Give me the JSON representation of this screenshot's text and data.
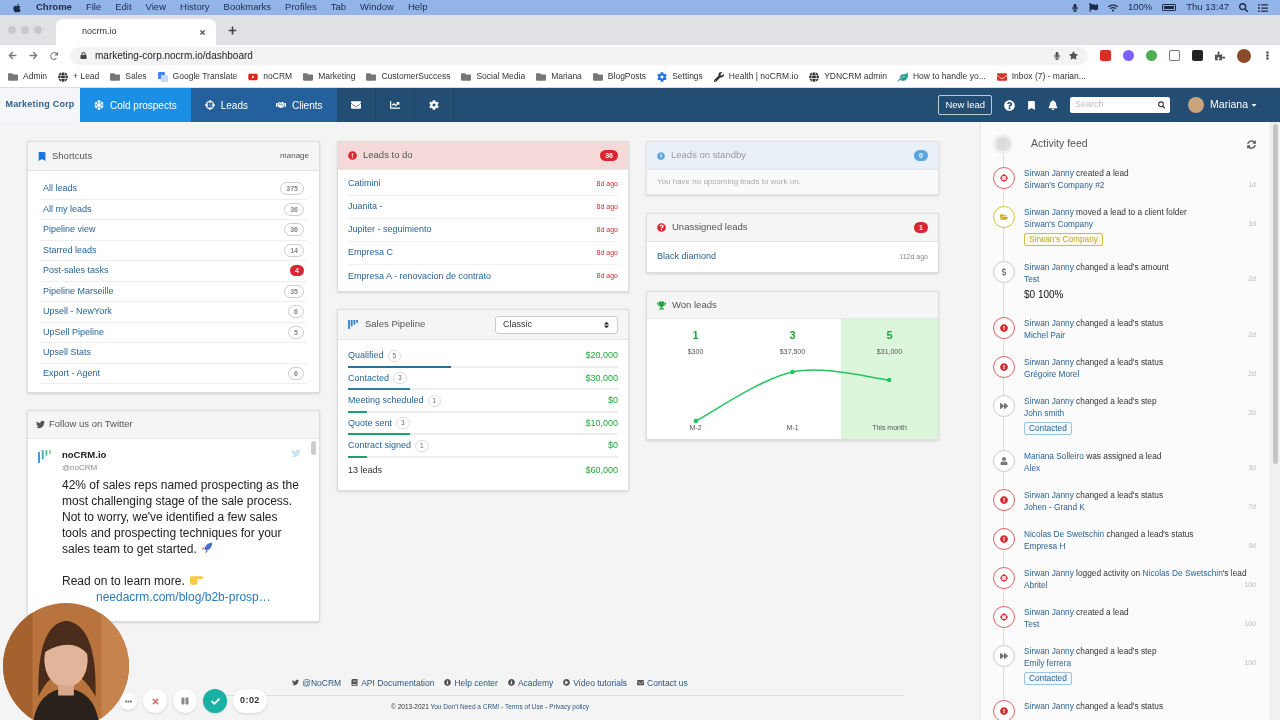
{
  "menu_bar": {
    "app": "Chrome",
    "items": [
      "File",
      "Edit",
      "View",
      "History",
      "Bookmarks",
      "Profiles",
      "Tab",
      "Window",
      "Help"
    ],
    "battery": "100%",
    "clock": "Thu 13:47"
  },
  "browser": {
    "tab": {
      "title": "nocrm.io"
    },
    "url": "marketing-corp.nocrm.io/dashboard",
    "bookmarks": [
      {
        "label": "Admin",
        "kind": "folder"
      },
      {
        "label": "+ Lead",
        "kind": "globe"
      },
      {
        "label": "Sales",
        "kind": "folder"
      },
      {
        "label": "Google Translate",
        "kind": "translate"
      },
      {
        "label": "noCRM",
        "kind": "video"
      },
      {
        "label": "Marketing",
        "kind": "folder"
      },
      {
        "label": "CustomerSuccess",
        "kind": "folder"
      },
      {
        "label": "Social Media",
        "kind": "folder"
      },
      {
        "label": "Mariana",
        "kind": "folder"
      },
      {
        "label": "BlogPosts",
        "kind": "folder"
      },
      {
        "label": "Settings",
        "kind": "gear"
      },
      {
        "label": "Health | noCRM.io",
        "kind": "tool"
      },
      {
        "label": "YDNCRM admin",
        "kind": "globe"
      },
      {
        "label": "How to handle yo...",
        "kind": "leaf"
      },
      {
        "label": "Inbox (7) - marian...",
        "kind": "mail"
      }
    ]
  },
  "nav": {
    "brand": "Marketing Corp",
    "items": [
      {
        "kind": "cold",
        "label": "Cold prospects",
        "selected": true
      },
      {
        "kind": "leads",
        "label": "Leads",
        "selected": false
      },
      {
        "kind": "clients",
        "label": "Clients",
        "selected": false
      },
      {
        "kind": "mail",
        "selected": false
      },
      {
        "kind": "reports",
        "selected": false
      },
      {
        "kind": "settings",
        "selected": false
      }
    ],
    "new_lead": "New lead",
    "search": {
      "placeholder": "Search"
    },
    "user": "Mariana"
  },
  "shortcuts": {
    "title": "Shortcuts",
    "manage": "manage",
    "items": [
      {
        "label": "All leads",
        "count": "375",
        "alert": false
      },
      {
        "label": "All my leads",
        "count": "36",
        "alert": false
      },
      {
        "label": "Pipeline view",
        "count": "36",
        "alert": false
      },
      {
        "label": "Starred leads",
        "count": "14",
        "alert": false
      },
      {
        "label": "Post-sales tasks",
        "count": "4",
        "alert": true
      },
      {
        "label": "Pipeline Marseille",
        "count": "35",
        "alert": false
      },
      {
        "label": "Upsell - NewYork",
        "count": "6",
        "alert": false
      },
      {
        "label": "UpSell Pipeline",
        "count": "5",
        "alert": false
      },
      {
        "label": "Upsell Stats",
        "alert": false
      },
      {
        "label": "Export - Agent",
        "count": "6",
        "alert": false
      }
    ]
  },
  "twitter": {
    "title": "Follow us on Twitter",
    "account": "noCRM.io",
    "handle": "@noCRM",
    "text": "42% of sales reps named prospecting as the most challenging stage of the sale process. Not to worry, we've identified a few sales tools and prospecting techniques for your sales team to get started.",
    "text_2": "Read on to learn more.",
    "link": "needacrm.com/blog/b2b-prosp…"
  },
  "leads_to_do": {
    "title": "Leads to do",
    "count": "36",
    "rows": [
      {
        "name": "Catimini",
        "age": "8d ago"
      },
      {
        "name": "Juanita -",
        "age": "8d ago"
      },
      {
        "name": "Jupiter - seguimiento",
        "age": "8d ago"
      },
      {
        "name": "Empresa C",
        "age": "8d ago"
      },
      {
        "name": "Empresa A - renovacion de contrato",
        "age": "8d ago"
      }
    ]
  },
  "sales_pipeline": {
    "title": "Sales Pipeline",
    "view": "Classic",
    "rows": [
      {
        "name": "Qualified",
        "count": "5",
        "amount": "$20,000",
        "level": 0.38,
        "color": "#2a6f97"
      },
      {
        "name": "Contacted",
        "count": "3",
        "amount": "$30,000",
        "level": 0.23,
        "color": "#2a7f9e"
      },
      {
        "name": "Meeting scheduled",
        "count": "1",
        "amount": "$0",
        "level": 0.07,
        "color": "#1f9e7a"
      },
      {
        "name": "Quote sent",
        "count": "3",
        "amount": "$10,000",
        "level": 0.23,
        "color": "#22a06b"
      },
      {
        "name": "Contract signed",
        "count": "1",
        "amount": "$0",
        "level": 0.07,
        "color": "#22a06b"
      }
    ],
    "total": {
      "label": "13 leads",
      "amount": "$60,000"
    }
  },
  "leads_on_standby": {
    "title": "Leads on standby",
    "count": "0",
    "empty": "You have no upcoming leads to work on."
  },
  "unassigned_leads": {
    "title": "Unassigned leads",
    "count": "1",
    "rows": [
      {
        "name": "Black diamond",
        "age": "112d ago"
      }
    ]
  },
  "won_leads": {
    "title": "Won leads",
    "columns": [
      {
        "count": "1",
        "amount": "$300",
        "label": "M-2",
        "selected": false
      },
      {
        "count": "3",
        "amount": "$37,500",
        "label": "M-1",
        "selected": false
      },
      {
        "count": "5",
        "amount": "$31,000",
        "label": "This month",
        "selected": true
      }
    ]
  },
  "activity_feed": {
    "title": "Activity feed",
    "items": [
      {
        "kind": "lead",
        "parts": [
          {
            "text": "Sirwan Janny",
            "link": true
          },
          {
            "text": " created a lead",
            "link": false
          }
        ],
        "target": "Sirwan's Company #2",
        "time": "1d"
      },
      {
        "kind": "folder",
        "parts": [
          {
            "text": "Sirwan Janny",
            "link": true
          },
          {
            "text": " moved a lead to a client folder",
            "link": false
          }
        ],
        "target": "Sirwan's Company",
        "time": "1d",
        "tag": {
          "kind": "client",
          "label": "Sirwan's Company"
        }
      },
      {
        "kind": "amount",
        "parts": [
          {
            "text": "Sirwan Janny",
            "link": true
          },
          {
            "text": " changed a lead's amount",
            "link": false
          }
        ],
        "target": "Test",
        "time": "2d",
        "note": "$0 100%"
      },
      {
        "kind": "status",
        "parts": [
          {
            "text": "Sirwan Janny",
            "link": true
          },
          {
            "text": " changed a lead's status",
            "link": false
          }
        ],
        "target": "Michel Pair",
        "time": "2d"
      },
      {
        "kind": "status",
        "parts": [
          {
            "text": "Sirwan Janny",
            "link": true
          },
          {
            "text": " changed a lead's status",
            "link": false
          }
        ],
        "target": "Grégoire Morel",
        "time": "2d"
      },
      {
        "kind": "step",
        "parts": [
          {
            "text": "Sirwan Janny",
            "link": true
          },
          {
            "text": " changed a lead's step",
            "link": false
          }
        ],
        "target": "John smith",
        "time": "2d",
        "tag": {
          "kind": "step",
          "label": "Contacted"
        }
      },
      {
        "kind": "user",
        "parts": [
          {
            "text": "Mariana Solleiro",
            "link": true
          },
          {
            "text": " was assigned a lead",
            "link": false
          }
        ],
        "target": "Alex",
        "time": "3d"
      },
      {
        "kind": "status",
        "parts": [
          {
            "text": "Sirwan Janny",
            "link": true
          },
          {
            "text": " changed a lead's status",
            "link": false
          }
        ],
        "target": "Johen - Grand K",
        "time": "7d"
      },
      {
        "kind": "status",
        "parts": [
          {
            "text": "Nicolas De Swetschin",
            "link": true
          },
          {
            "text": " changed a lead's status",
            "link": false
          }
        ],
        "target": "Empresa H",
        "time": "9d"
      },
      {
        "kind": "lead",
        "parts": [
          {
            "text": "Sirwan Janny",
            "link": true
          },
          {
            "text": " logged activity on ",
            "link": false
          },
          {
            "text": "Nicolas De Swetschin",
            "link": true
          },
          {
            "text": "'s lead",
            "link": false
          }
        ],
        "target": "Abritel",
        "time": "10d"
      },
      {
        "kind": "lead",
        "parts": [
          {
            "text": "Sirwan Janny",
            "link": true
          },
          {
            "text": " created a lead",
            "link": false
          }
        ],
        "target": "Test",
        "time": "10d"
      },
      {
        "kind": "step",
        "parts": [
          {
            "text": "Sirwan Janny",
            "link": true
          },
          {
            "text": " changed a lead's step",
            "link": false
          }
        ],
        "target": "Emily ferrera",
        "time": "10d",
        "tag": {
          "kind": "step",
          "label": "Contacted"
        }
      },
      {
        "kind": "status",
        "parts": [
          {
            "text": "Sirwan Janny",
            "link": true
          },
          {
            "text": " changed a lead's status",
            "link": false
          }
        ]
      }
    ]
  },
  "footer": {
    "links": [
      {
        "kind": "twitter",
        "label": "@NoCRM"
      },
      {
        "kind": "book",
        "label": "API Documentation"
      },
      {
        "kind": "info",
        "label": "Help center"
      },
      {
        "kind": "info",
        "label": "Academy"
      },
      {
        "kind": "play",
        "label": "Video tutorials"
      },
      {
        "kind": "mail",
        "label": "Contact us"
      }
    ],
    "copyright": [
      {
        "text": "© 2013-2021 ",
        "kind": "text"
      },
      {
        "text": "You Don't Need a CRM!",
        "kind": "link"
      },
      {
        "text": " - ",
        "kind": "text"
      },
      {
        "text": "Terms of Use",
        "kind": "link"
      },
      {
        "text": " - ",
        "kind": "text"
      },
      {
        "text": "Privacy policy",
        "kind": "link"
      }
    ]
  },
  "recorder": {
    "time": "0:02"
  }
}
